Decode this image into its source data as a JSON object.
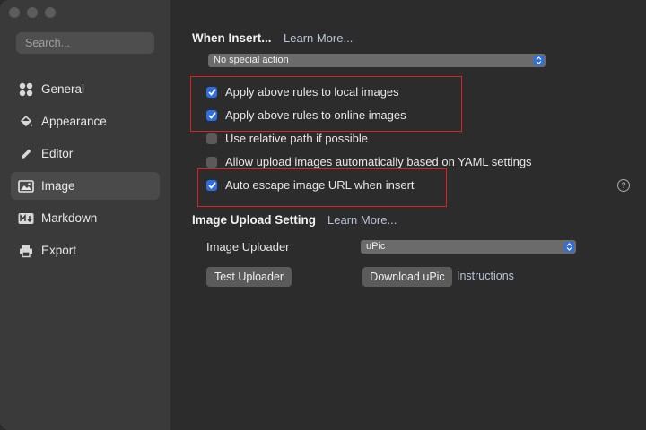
{
  "sidebar": {
    "search_placeholder": "Search...",
    "items": [
      {
        "label": "General",
        "icon": "grid-icon",
        "active": false
      },
      {
        "label": "Appearance",
        "icon": "paint-bucket-icon",
        "active": false
      },
      {
        "label": "Editor",
        "icon": "pencil-icon",
        "active": false
      },
      {
        "label": "Image",
        "icon": "image-icon",
        "active": true
      },
      {
        "label": "Markdown",
        "icon": "markdown-icon",
        "active": false
      },
      {
        "label": "Export",
        "icon": "printer-icon",
        "active": false
      }
    ]
  },
  "when_insert": {
    "title": "When Insert...",
    "learn_more": "Learn More...",
    "select_value": "No special action",
    "options": [
      {
        "label": "Apply above rules to local images",
        "checked": true
      },
      {
        "label": "Apply above rules to online images",
        "checked": true
      },
      {
        "label": "Use relative path if possible",
        "checked": false
      },
      {
        "label": "Allow upload images automatically based on YAML settings",
        "checked": false
      },
      {
        "label": "Auto escape image URL when insert",
        "checked": true
      }
    ],
    "help_glyph": "?"
  },
  "upload": {
    "title": "Image Upload Setting",
    "learn_more": "Learn More...",
    "uploader_label": "Image Uploader",
    "uploader_value": "uPic",
    "test_button": "Test Uploader",
    "download_button": "Download uPic",
    "instructions_link": "Instructions"
  },
  "colors": {
    "accent": "#2f6ee0",
    "annotation": "#e02020"
  }
}
